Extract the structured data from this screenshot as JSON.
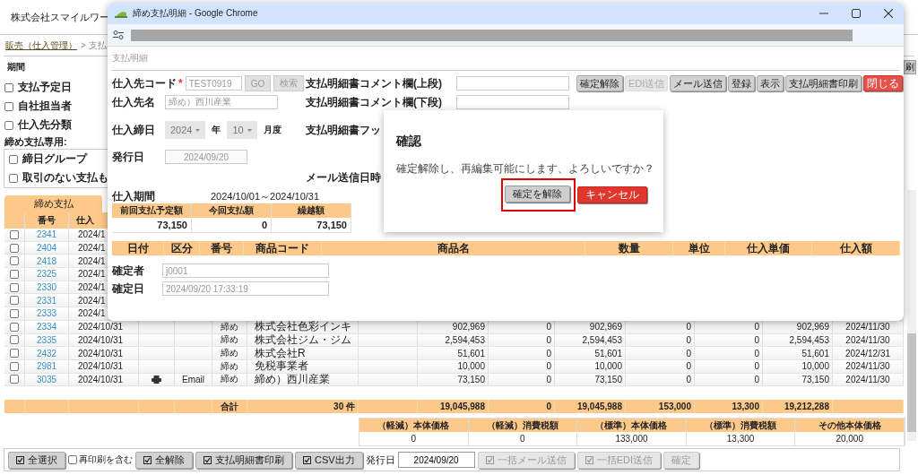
{
  "page": {
    "company": "株式会社スマイルワー",
    "breadcrumb": [
      {
        "label": "販売（仕入管理）",
        "kind": "link"
      },
      {
        "label": "> 支払",
        "kind": "text"
      }
    ],
    "corner_button": "刷",
    "filters": {
      "period_label": "期間",
      "options": [
        {
          "label": "支払予定日",
          "checked": false
        },
        {
          "label": "自社担当者",
          "checked": false
        },
        {
          "label": "仕入先分類",
          "checked": false
        }
      ],
      "closing_label": "締め支払専用:",
      "closing_options": [
        {
          "label": "締日グループ",
          "checked": false
        },
        {
          "label": "取引のない支払も",
          "checked": false
        }
      ]
    },
    "tab": {
      "label": "締め支払",
      "selected": true
    },
    "table": {
      "columns": [
        "番号",
        "仕入"
      ],
      "rows": [
        {
          "checked": false,
          "number": "2341",
          "date": "2024/1"
        },
        {
          "checked": false,
          "number": "2404",
          "date": "2024/1"
        },
        {
          "checked": false,
          "number": "2418",
          "date": "2024/1"
        },
        {
          "checked": false,
          "number": "2325",
          "date": "2024/1"
        },
        {
          "checked": false,
          "number": "2330",
          "date": "2024/1"
        },
        {
          "checked": false,
          "number": "2331",
          "date": "2024/1"
        },
        {
          "checked": false,
          "number": "2333",
          "date": "2024/1"
        },
        {
          "checked": false,
          "number": "2334",
          "date": "2024/10/31",
          "printed": false,
          "category": "締め",
          "supplier": "株式会社色彩インキ",
          "amounts": [
            "902,969",
            "0",
            "902,969",
            "0",
            "0",
            "902,969",
            "2024/11/30"
          ]
        },
        {
          "checked": false,
          "number": "2335",
          "date": "2024/10/31",
          "printed": false,
          "category": "締め",
          "supplier": "株式会社ジム・ジム",
          "amounts": [
            "2,594,453",
            "0",
            "2,594,453",
            "0",
            "0",
            "2,594,453",
            "2024/11/30"
          ]
        },
        {
          "checked": false,
          "number": "2432",
          "date": "2024/10/31",
          "printed": false,
          "category": "締め",
          "supplier": "株式会社R",
          "amounts": [
            "51,601",
            "0",
            "51,601",
            "0",
            "0",
            "51,601",
            "2024/12/31"
          ]
        },
        {
          "checked": false,
          "number": "2981",
          "date": "2024/10/31",
          "printed": false,
          "category": "締め",
          "supplier": "免税事業者",
          "amounts": [
            "10,000",
            "0",
            "10,000",
            "0",
            "0",
            "10,000",
            "2024/11/30"
          ]
        },
        {
          "checked": false,
          "number": "3035",
          "date": "2024/10/31",
          "printed": true,
          "send": "Email",
          "category": "締め",
          "supplier": "締め）西川産業",
          "amounts": [
            "73,150",
            "0",
            "73,150",
            "0",
            "0",
            "73,150",
            "2024/11/30"
          ]
        }
      ],
      "total": {
        "label": "合計",
        "count": "30 件",
        "amounts": [
          "19,045,988",
          "0",
          "19,045,988",
          "153,000",
          "13,300",
          "19,212,288"
        ]
      }
    },
    "tax_table": {
      "columns": [
        "（軽減）本体価格",
        "（軽減）消費税額",
        "（標準）本体価格",
        "（標準）消費税額",
        "その他本体価格"
      ],
      "values": [
        "0",
        "0",
        "133,000",
        "13,300",
        "20,000"
      ]
    },
    "toolbar": [
      {
        "kind": "button",
        "label": "全選択",
        "disabled": false
      },
      {
        "kind": "checkbox",
        "label": "再印刷を含む",
        "checked": false
      },
      {
        "kind": "button",
        "label": "全解除",
        "disabled": false
      },
      {
        "kind": "button",
        "label": "支払明細書印刷",
        "disabled": false
      },
      {
        "kind": "button",
        "label": "CSV出力",
        "disabled": false
      },
      {
        "kind": "label",
        "label": "発行日"
      },
      {
        "kind": "date",
        "value": "2024/09/20"
      },
      {
        "kind": "button",
        "label": "一括メール送信",
        "disabled": true
      },
      {
        "kind": "button",
        "label": "一括EDI送信",
        "disabled": true
      },
      {
        "kind": "plain",
        "label": "確定",
        "disabled": true
      }
    ]
  },
  "popup": {
    "title": "締め支払明細 - Google Chrome",
    "section": "支払明細",
    "supplier_code": {
      "label": "仕入先コード",
      "required_mark": "*",
      "value": "TEST0919",
      "buttons": [
        "GO",
        "検索"
      ]
    },
    "supplier_name": {
      "label": "仕入先名",
      "value": "締め）西川産業"
    },
    "closing": {
      "label": "仕入締日",
      "year": "2024",
      "year_unit": "年",
      "month": "10",
      "month_unit": "月度"
    },
    "issue_date": {
      "label": "発行日",
      "value": "2024/09/20"
    },
    "comments": [
      {
        "label": "支払明細書コメント欄(上段)",
        "kind": "input"
      },
      {
        "label": "支払明細書コメント欄(下段)",
        "kind": "input"
      },
      {
        "label": "支払明細書フッ",
        "kind": "label"
      },
      {
        "label": "メール送信日時",
        "kind": "label"
      }
    ],
    "actions": [
      {
        "label": "確定解除",
        "kind": "normal",
        "disabled": false
      },
      {
        "label": "EDI送信",
        "kind": "normal",
        "disabled": true
      },
      {
        "label": "メール送信",
        "kind": "normal",
        "disabled": false
      },
      {
        "label": "登録",
        "kind": "normal",
        "disabled": false
      },
      {
        "label": "表示",
        "kind": "normal",
        "disabled": false
      },
      {
        "label": "支払明細書印刷",
        "kind": "normal",
        "disabled": false
      },
      {
        "label": "閉じる",
        "kind": "danger",
        "disabled": false
      }
    ],
    "period": {
      "label": "仕入期間",
      "value": "2024/10/01～2024/10/31"
    },
    "summary": {
      "columns": [
        "前回支払予定額",
        "今回支払額",
        "繰越額"
      ],
      "values": [
        "73,150",
        "0",
        "73,150"
      ]
    },
    "detail_columns": [
      "日付",
      "区分",
      "番号",
      "商品コード",
      "商品名",
      "数量",
      "単位",
      "仕入単価",
      "仕入額"
    ],
    "confirmer": {
      "label": "確定者",
      "value": "j0001"
    },
    "confirmed_at": {
      "label": "確定日",
      "value": "2024/09/20 17:33:19"
    }
  },
  "dialog": {
    "title": "確認",
    "message": "確定解除し、再編集可能にします、よろしいですか？",
    "buttons": [
      {
        "label": "確定を解除",
        "kind": "normal",
        "highlighted": true
      },
      {
        "label": "キャンセル",
        "kind": "danger",
        "highlighted": false
      }
    ]
  }
}
